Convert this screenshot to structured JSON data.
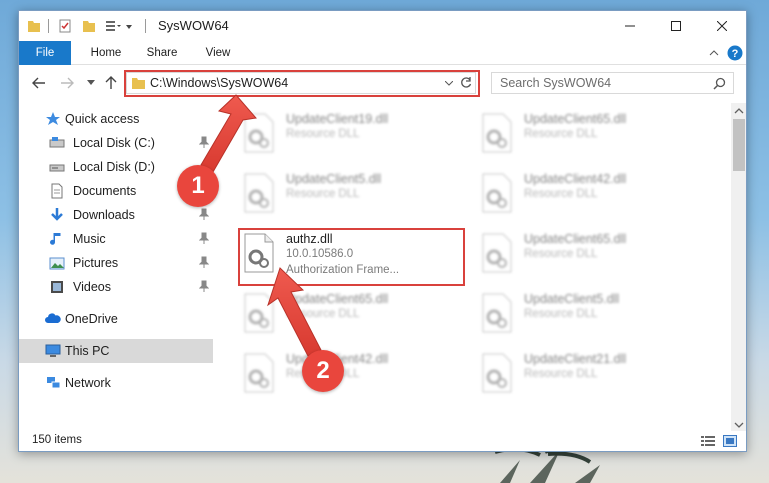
{
  "window": {
    "title": "SysWOW64"
  },
  "ribbon": {
    "tabs": [
      "File",
      "Home",
      "Share",
      "View"
    ]
  },
  "address": {
    "path": "C:\\Windows\\SysWOW64",
    "search_placeholder": "Search SysWOW64"
  },
  "sidebar": {
    "items": [
      {
        "label": "Quick access",
        "icon": "star-icon"
      },
      {
        "label": "Local Disk (C:)",
        "icon": "drive-icon"
      },
      {
        "label": "Local Disk (D:)",
        "icon": "drive-icon"
      },
      {
        "label": "Documents",
        "icon": "documents-icon"
      },
      {
        "label": "Downloads",
        "icon": "downloads-icon"
      },
      {
        "label": "Music",
        "icon": "music-icon"
      },
      {
        "label": "Pictures",
        "icon": "pictures-icon"
      },
      {
        "label": "Videos",
        "icon": "videos-icon"
      },
      {
        "label": "OneDrive",
        "icon": "onedrive-icon"
      },
      {
        "label": "This PC",
        "icon": "computer-icon",
        "selected": true
      },
      {
        "label": "Network",
        "icon": "network-icon"
      }
    ]
  },
  "files": [
    {
      "name": "UpdateClient19.dll",
      "type": "Resource DLL"
    },
    {
      "name": "UpdateClient65.dll",
      "type": "Resource DLL"
    },
    {
      "name": "UpdateClient5.dll",
      "type": "Resource DLL"
    },
    {
      "name": "UpdateClient42.dll",
      "type": "Resource DLL"
    },
    {
      "name": "authz.dll",
      "version": "10.0.10586.0",
      "description": "Authorization Frame..."
    },
    {
      "name": "UpdateClient65.dll",
      "type": "Resource DLL"
    },
    {
      "name": "UpdateClient65.dll",
      "type": "Resource DLL"
    },
    {
      "name": "UpdateClient5.dll",
      "type": "Resource DLL"
    },
    {
      "name": "UpdateClient42.dll",
      "type": "Resource DLL"
    },
    {
      "name": "UpdateClient21.dll",
      "type": "Resource DLL"
    }
  ],
  "status": {
    "item_count": "150 items"
  },
  "annotations": {
    "step1": "1",
    "step2": "2"
  },
  "colors": {
    "accent": "#1979ca",
    "highlight": "#d9413c",
    "badge": "#e9463d"
  }
}
